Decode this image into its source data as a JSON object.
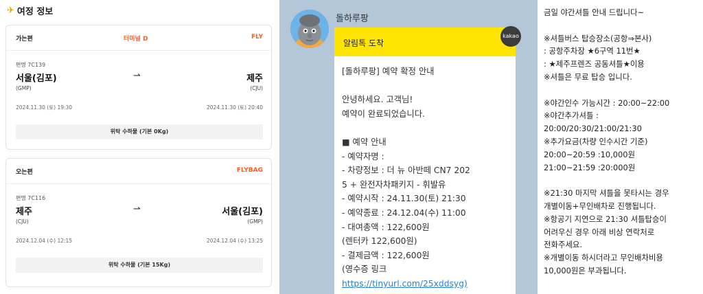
{
  "itinerary": {
    "title": "여정 정보",
    "outbound": {
      "label": "가는편",
      "terminal": "터미널 D",
      "airline": "FLY",
      "flight": "편명 7C139",
      "from_city": "서울(김포)",
      "from_code": "(GMP)",
      "to_city": "제주",
      "to_code": "(CJU)",
      "arrow": "⇀",
      "depart_time": "2024.11.30 (토) 19:30",
      "arrive_time": "2024.11.30 (토) 20:40",
      "baggage": "위탁 수하물 (기본 0Kg)"
    },
    "inbound": {
      "label": "오는편",
      "airline": "FLYBAG",
      "flight": "편명 7C116",
      "from_city": "제주",
      "from_code": "(CJU)",
      "to_city": "서울(김포)",
      "to_code": "(GMP)",
      "arrow": "⇀",
      "depart_time": "2024.12.04 (수) 12:15",
      "arrive_time": "2024.12.04 (수) 13:25",
      "baggage": "위탁 수하물 (기본 15Kg)"
    }
  },
  "chat": {
    "sender": "돌하루팡",
    "header": "알림톡 도착",
    "badge": "kakao",
    "lines": [
      "[돌하루팡] 예약 확정 안내",
      "",
      "안녕하세요.           고객님!",
      "예약이 완료되었습니다.",
      "",
      "■ 예약 안내",
      "- 예약자명 :",
      "- 차량정보 : 더 뉴 아반떼 CN7 202",
      "5 + 완전자차패키지 - 휘발유",
      "- 예약시작 : 24.11.30(토) 21:30",
      "- 예약종료 : 24.12.04(수) 11:00",
      "- 대여총액 : 122,600원",
      "(렌터카 122,600원)",
      "- 결제금액 : 122,600원",
      "(영수증 링크"
    ],
    "receipt_link": "https://tinyurl.com/25xddsyg)",
    "avatar_icon": "dol-harubang-character-icon",
    "colors": {
      "background": "#b4c7d9",
      "header": "#ffe500",
      "link": "#2a7fd4"
    }
  },
  "shuttle": {
    "lines": [
      "금일 야간셔틀 안내 드립니다~",
      "",
      "※셔틀버스 탑승장소(공항⇒본사)",
      " : 공항주차장 ★6구역 11번★",
      " : ★제주프렌즈 공동셔틀★이용",
      "※셔틀은 무료 탑승 입니다.",
      "",
      "※야간인수 가능시간 : 20:00~22:00",
      "※야간추가셔틀 :",
      "20:00/20:30/21:00/21:30",
      "※추가요금(차량 인수시간 기준)",
      "20:00~20:59 :10,000원",
      "21:00~21:59 :20:000원",
      "",
      "※21:30 마지막 셔틀을 못타시는 경우",
      "개별이동+무인배차로 진행됩니다.",
      "※항공기 지연으로 21:30 셔틀탑승이",
      "어려우신 경우 아래 비상 연락처로",
      "전화주세요.",
      "※개별이동 하시더라고 무인배차비용",
      "10,000원은 부과됩니다."
    ]
  },
  "accent_color": "#ff5a1f"
}
